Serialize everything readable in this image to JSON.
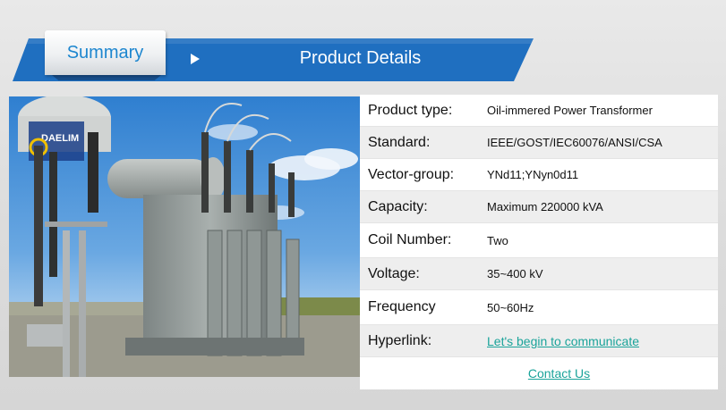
{
  "banner": {
    "tab_label": "Summary",
    "title": "Product Details",
    "band_color": "#1f6fc0",
    "tab_text_color": "#1d86cf"
  },
  "photo": {
    "subject": "oil-immersed power transformer at substation",
    "logo_text": "DAELIM"
  },
  "details": {
    "rows": [
      {
        "label": "Product type:",
        "value": "Oil-immered Power Transformer"
      },
      {
        "label": "Standard:",
        "value": "IEEE/GOST/IEC60076/ANSI/CSA"
      },
      {
        "label": "Vector-group:",
        "value": "YNd11;YNyn0d11"
      },
      {
        "label": "Capacity:",
        "value": "Maximum 220000 kVA"
      },
      {
        "label": "Coil Number:",
        "value": "Two"
      },
      {
        "label": "Voltage:",
        "value": "35~400 kV"
      },
      {
        "label": "Frequency",
        "value": "50~60Hz"
      },
      {
        "label": "Hyperlink:",
        "value": "Let's begin to communicate"
      }
    ],
    "contact_link": "Contact Us",
    "link_color": "#1aa39a"
  }
}
